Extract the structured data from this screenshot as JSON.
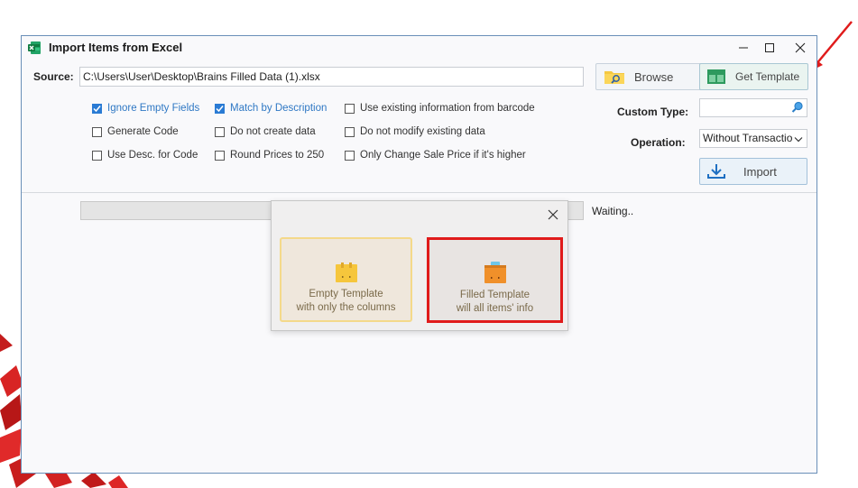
{
  "window": {
    "title": "Import Items from Excel",
    "controls": {
      "minimize": "—",
      "maximize": "☐",
      "close": "✕"
    }
  },
  "source": {
    "label": "Source:",
    "value": "C:\\Users\\User\\Desktop\\Brains Filled Data (1).xlsx"
  },
  "buttons": {
    "browse": "Browse",
    "get_template": "Get Template",
    "import": "Import"
  },
  "options": [
    {
      "label": "Ignore Empty Fields",
      "checked": true
    },
    {
      "label": "Generate Code",
      "checked": false
    },
    {
      "label": "Use Desc. for Code",
      "checked": false
    },
    {
      "label": "Match by Description",
      "checked": true
    },
    {
      "label": "Do not create data",
      "checked": false
    },
    {
      "label": "Round Prices to 250",
      "checked": false
    },
    {
      "label": "Use existing information from barcode",
      "checked": false
    },
    {
      "label": "Do not modify existing data",
      "checked": false
    },
    {
      "label": "Only Change Sale Price if it's higher",
      "checked": false
    }
  ],
  "custom_type": {
    "label": "Custom Type:",
    "value": ""
  },
  "operation": {
    "label": "Operation:",
    "value": "Without Transactio"
  },
  "progress": {
    "value": 0.0,
    "status": "Waiting.."
  },
  "template_popup": {
    "empty": {
      "line1": "Empty Template",
      "line2": "with only the columns"
    },
    "filled": {
      "line1": "Filled Template",
      "line2": "will all items' info"
    }
  },
  "colors": {
    "accent_blue": "#2a7bd4",
    "highlight_red": "#e01b1b",
    "window_border": "#6a8fb8"
  },
  "icons": [
    "excel-icon",
    "folder-search-icon",
    "template-grid-icon",
    "search-icon",
    "chevron-down-icon",
    "download-icon",
    "close-icon",
    "empty-box-icon",
    "filled-box-icon"
  ]
}
